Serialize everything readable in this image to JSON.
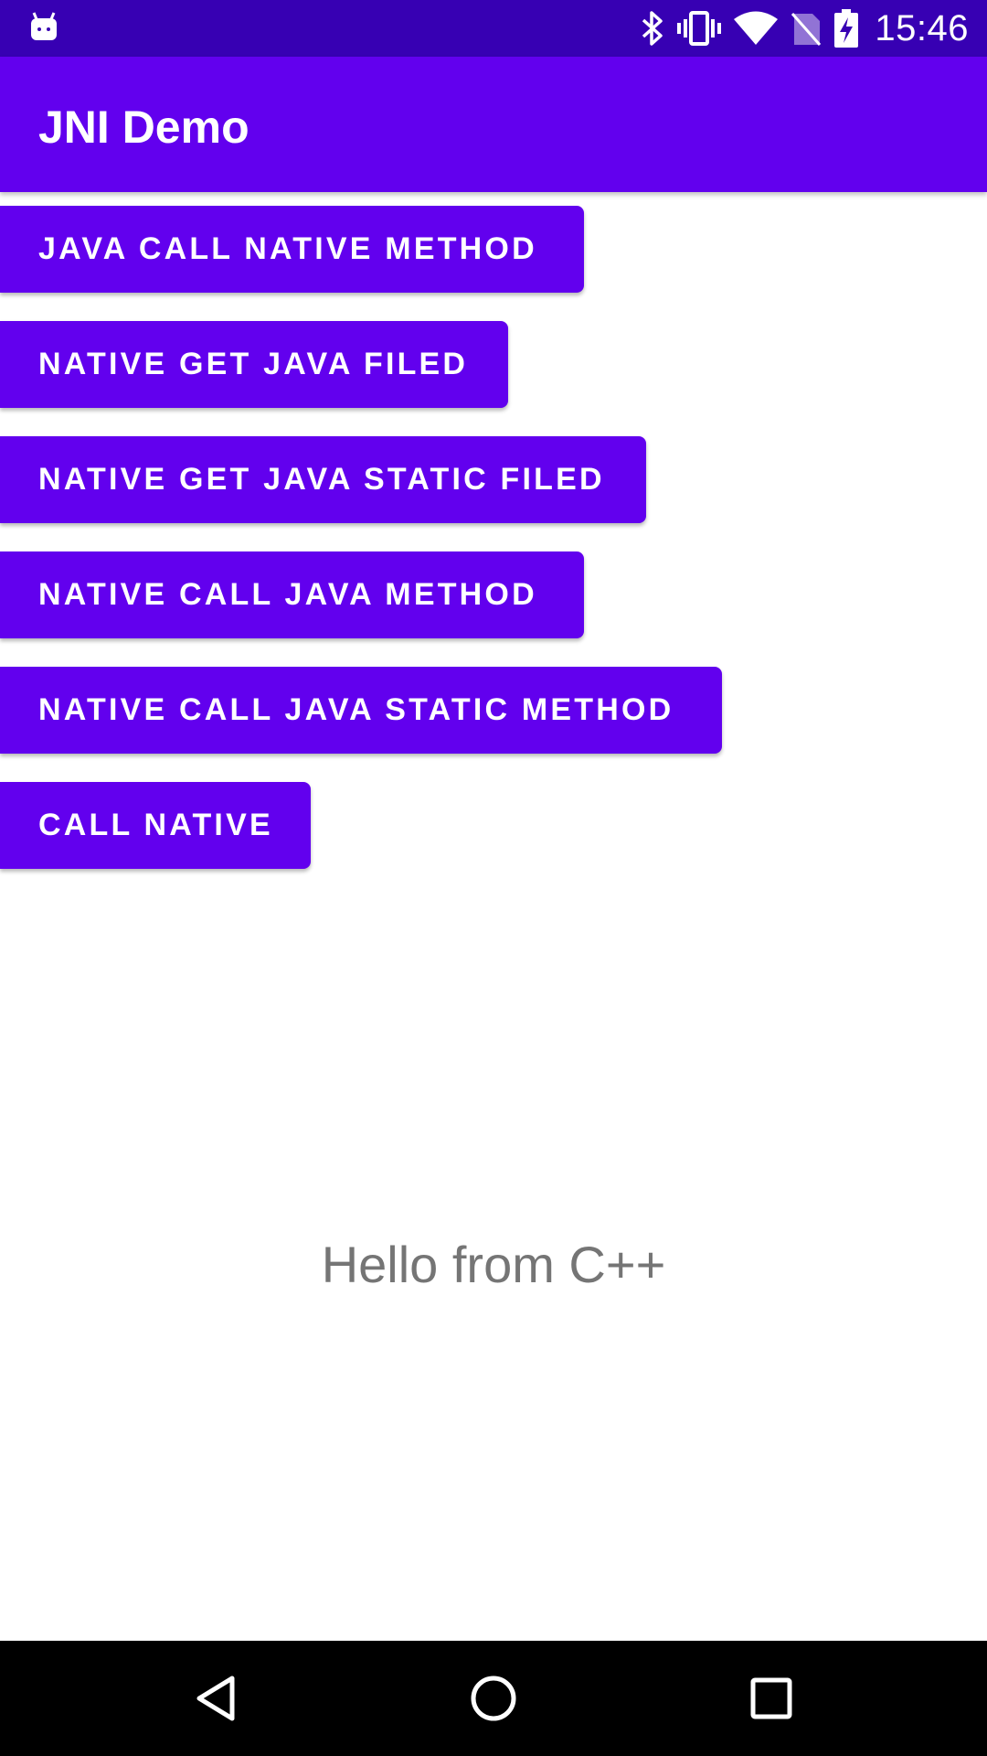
{
  "status_bar": {
    "time": "15:46",
    "icons": [
      "android-debug-icon",
      "bluetooth-icon",
      "vibrate-icon",
      "wifi-icon",
      "no-sim-icon",
      "battery-charging-icon"
    ]
  },
  "app_bar": {
    "title": "JNI Demo"
  },
  "buttons": [
    {
      "label": "JAVA CALL NATIVE METHOD"
    },
    {
      "label": "NATIVE GET JAVA FILED"
    },
    {
      "label": "NATIVE GET JAVA STATIC FILED"
    },
    {
      "label": "NATIVE CALL JAVA METHOD"
    },
    {
      "label": "NATIVE CALL JAVA STATIC METHOD"
    },
    {
      "label": "CALL NATIVE"
    }
  ],
  "result": {
    "text": "Hello from C++"
  },
  "nav_bar": {
    "icons": [
      "back-icon",
      "home-icon",
      "recents-icon"
    ]
  },
  "colors": {
    "primary": "#6200ee",
    "primary_dark": "#3700b3",
    "result_text": "#757575"
  }
}
